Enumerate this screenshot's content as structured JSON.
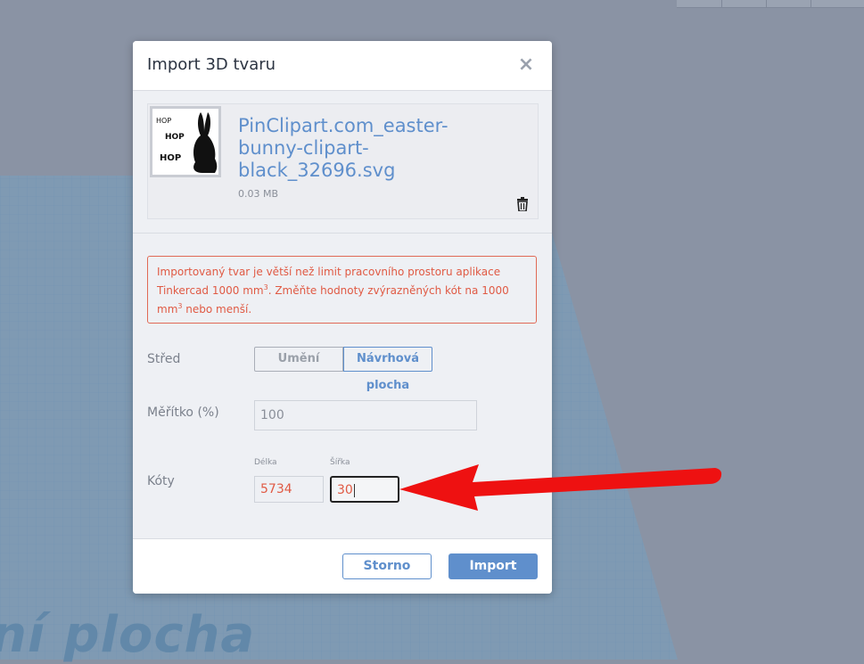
{
  "background": {
    "workplane_label": "ní plocha"
  },
  "dialog": {
    "title": "Import 3D tvaru",
    "close_icon": "close-icon",
    "file": {
      "name": "PinClipart.com_easter-bunny-clipart-black_32696.svg",
      "name_lines": [
        "PinClipart.com_easter-",
        "bunny-clipart-",
        "black_32696.svg"
      ],
      "size": "0.03 MB",
      "thumbnail_text": [
        "HOP",
        "HOP",
        "HOP"
      ]
    },
    "error": {
      "part1": "Importovaný tvar je větší než limit pracovního prostoru aplikace Tinkercad 1000 mm",
      "sup1": "3",
      "part2": ". Změňte hodnoty zvýrazněných kót na 1000 mm",
      "sup2": "3",
      "part3": " nebo menší."
    },
    "center": {
      "label": "Střed",
      "option_art": "Umění",
      "option_workplane_line1": "Návrhová",
      "option_workplane_line2": "plocha"
    },
    "scale": {
      "label": "Měřítko (%)",
      "value": "100"
    },
    "dimensions": {
      "label": "Kóty",
      "length_label": "Délka",
      "length_value": "5734",
      "width_label": "Šířka",
      "width_value": "30"
    },
    "buttons": {
      "cancel": "Storno",
      "import": "Import"
    }
  },
  "colors": {
    "accent": "#5f8fcc",
    "error": "#e05a44",
    "arrow": "#ee1111"
  }
}
